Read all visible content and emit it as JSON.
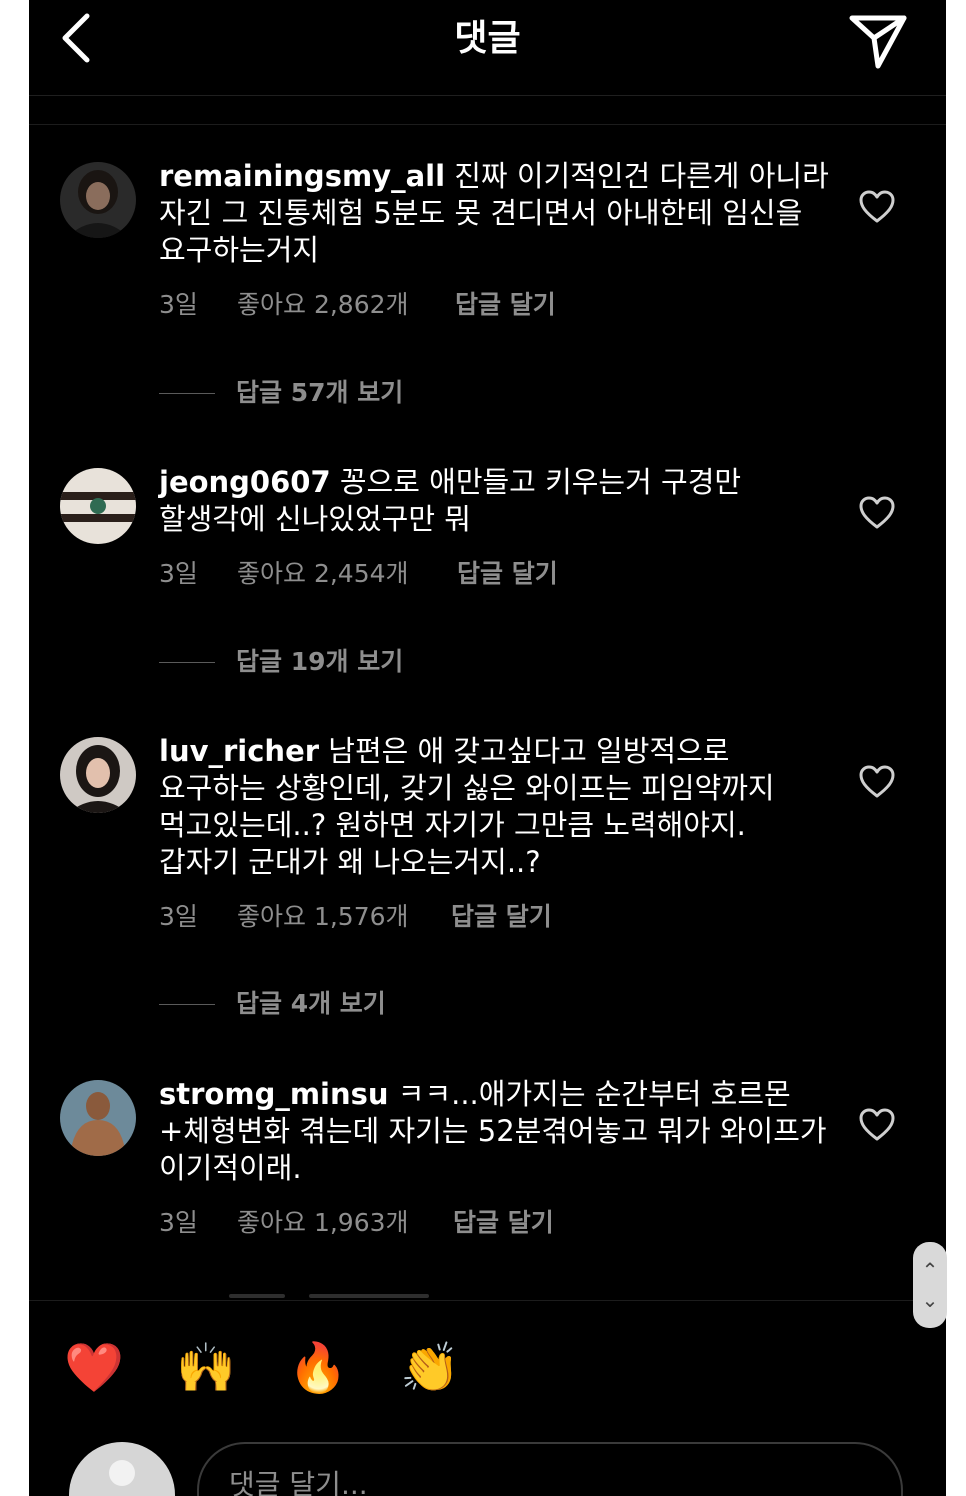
{
  "header": {
    "title": "댓글",
    "back_icon": "chevron-left-icon",
    "share_icon": "send-icon"
  },
  "comments": [
    {
      "username": "remainingsmy_all",
      "text": " 진짜 이기적인건 다른게 아니라 자긴 그 진통체험 5분도 못 견디면서 아내한테 임신을 요구하는거지",
      "time": "3일",
      "likes": "좋아요 2,862개",
      "reply_label": "답글 달기",
      "view_replies": "답글 57개 보기"
    },
    {
      "username": "jeong0607",
      "text": " 꽁으로 애만들고 키우는거 구경만 할생각에 신나있었구만 뭐",
      "time": "3일",
      "likes": "좋아요 2,454개",
      "reply_label": "답글 달기",
      "view_replies": "답글 19개 보기"
    },
    {
      "username": "luv_richer",
      "text": " 남편은 애 갖고싶다고 일방적으로 요구하는 상황인데, 갖기 싫은 와이프는 피임약까지 먹고있는데..? 원하면 자기가 그만큼 노력해야지. 갑자기 군대가 왜 나오는거지..?",
      "time": "3일",
      "likes": "좋아요 1,576개",
      "reply_label": "답글 달기",
      "view_replies": "답글 4개 보기"
    },
    {
      "username": "stromg_minsu",
      "text": " ㅋㅋ...애가지는 순간부터 호르몬+체형변화 겪는데 자기는 52분겪어놓고 뭐가 와이프가 이기적이래.",
      "time": "3일",
      "likes": "좋아요 1,963개",
      "reply_label": "답글 달기"
    }
  ],
  "emoji_bar": [
    "❤️",
    "🙌",
    "🔥",
    "👏",
    "😢",
    "😍",
    "😮",
    "😂"
  ],
  "composer": {
    "placeholder": "댓글 달기..."
  },
  "colors": {
    "background": "#000000",
    "text": "#ffffff",
    "muted": "#8e8e8e"
  }
}
